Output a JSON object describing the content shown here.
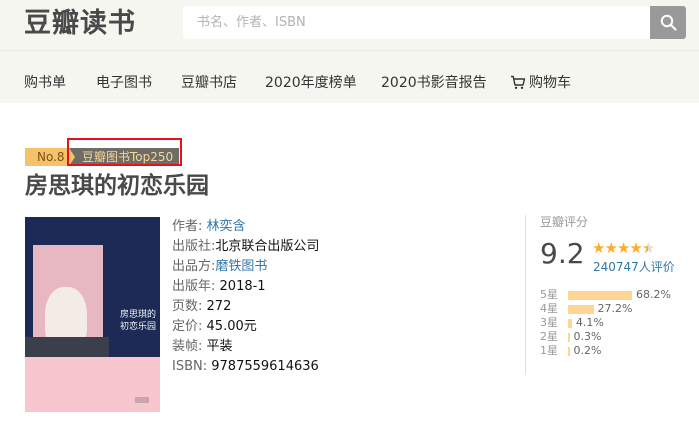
{
  "header": {
    "logo": "豆瓣读书",
    "search_placeholder": "书名、作者、ISBN"
  },
  "nav": {
    "items": [
      "购书单",
      "电子图书",
      "豆瓣书店",
      "2020年度榜单",
      "2020书影音报告",
      "购物车"
    ]
  },
  "top250": {
    "rank": "No.8",
    "label": "豆瓣图书Top250"
  },
  "book": {
    "title": "房思琪的初恋乐园",
    "cover_text": "房思琪的初恋乐园",
    "author_label": "作者:",
    "author": "林奕含",
    "publisher_label": "出版社:",
    "publisher": "北京联合出版公司",
    "producer_label": "出品方:",
    "producer": "磨铁图书",
    "pubyear_label": "出版年:",
    "pubyear": "2018-1",
    "pages_label": "页数:",
    "pages": "272",
    "price_label": "定价:",
    "price": "45.00元",
    "binding_label": "装帧:",
    "binding": "平装",
    "isbn_label": "ISBN:",
    "isbn": "9787559614636"
  },
  "rating": {
    "title": "豆瓣评分",
    "score": "9.2",
    "stars_value": 4.5,
    "votes": "240747人评价",
    "breakdown": [
      {
        "label": "5星",
        "percent": "68.2%",
        "value": 68.2
      },
      {
        "label": "4星",
        "percent": "27.2%",
        "value": 27.2
      },
      {
        "label": "3星",
        "percent": "4.1%",
        "value": 4.1
      },
      {
        "label": "2星",
        "percent": "0.3%",
        "value": 0.3
      },
      {
        "label": "1星",
        "percent": "0.2%",
        "value": 0.2
      }
    ]
  },
  "colors": {
    "link": "#3377aa",
    "star": "#ffac2d",
    "bar": "#ffd596",
    "highlight": "#e8101a"
  }
}
